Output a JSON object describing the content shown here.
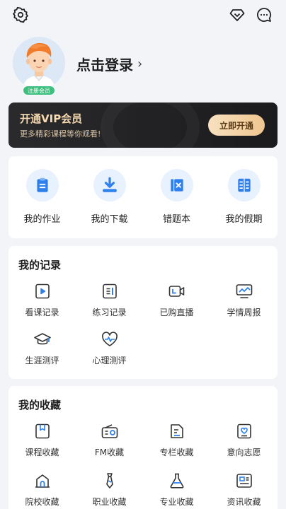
{
  "header": {
    "icons": [
      "gear-icon",
      "diamond-icon",
      "message-icon"
    ]
  },
  "profile": {
    "badge": "注册会员",
    "login_text": "点击登录",
    "chevron": "›"
  },
  "vip": {
    "title": "开通VIP会员",
    "subtitle": "更多精彩课程等你观看!",
    "button": "立即开通",
    "colors": {
      "text": "#f5d9b0",
      "button_start": "#f8e1c0",
      "button_end": "#f0c690"
    }
  },
  "quick_actions": [
    {
      "label": "我的作业",
      "icon": "clipboard-icon"
    },
    {
      "label": "我的下载",
      "icon": "download-icon"
    },
    {
      "label": "错题本",
      "icon": "wrong-book-icon"
    },
    {
      "label": "我的假期",
      "icon": "holiday-book-icon"
    }
  ],
  "records": {
    "title": "我的记录",
    "items": [
      {
        "label": "看课记录",
        "icon": "play-icon"
      },
      {
        "label": "练习记录",
        "icon": "exercise-icon"
      },
      {
        "label": "已购直播",
        "icon": "live-camera-icon"
      },
      {
        "label": "学情周报",
        "icon": "report-chart-icon"
      },
      {
        "label": "生涯测评",
        "icon": "graduation-cap-icon"
      },
      {
        "label": "心理测评",
        "icon": "heart-pulse-icon"
      }
    ]
  },
  "favorites": {
    "title": "我的收藏",
    "items": [
      {
        "label": "课程收藏",
        "icon": "course-bookmark-icon"
      },
      {
        "label": "FM收藏",
        "icon": "radio-icon"
      },
      {
        "label": "专栏收藏",
        "icon": "column-doc-icon"
      },
      {
        "label": "意向志愿",
        "icon": "heart-card-icon"
      },
      {
        "label": "院校收藏",
        "icon": "school-icon"
      },
      {
        "label": "职业收藏",
        "icon": "tie-icon"
      },
      {
        "label": "专业收藏",
        "icon": "flask-icon"
      },
      {
        "label": "资讯收藏",
        "icon": "news-icon"
      }
    ]
  },
  "colors": {
    "accent": "#2f80ed",
    "icon_bg": "#e8f1fe",
    "badge": "#3fbf7f"
  }
}
